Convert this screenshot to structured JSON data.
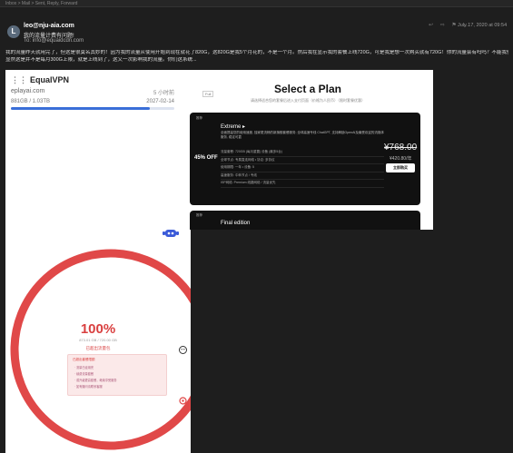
{
  "topbar": {
    "text": "Inbox > Mail > Sent, Reply, Forward"
  },
  "email": {
    "avatar_letter": "L",
    "from": "leo@nju-aia.com",
    "subject": "我的流量计费有问题!",
    "to_label": "To:",
    "to": "info@equaidcdn.com",
    "date": "July 17, 2020 at 09:54",
    "body_lines": [
      "我的流量昨天就用完了，但这是很莫名其妙的！因为我的流量从使用开始到现在就花了820G，这820G是我5个月花的，不是一个月。然后我在显示我的套餐上线720G，可是我是想一次购买就有720G！你的流量会有吗吗？不能我使用时累计，算上前面周期用完的量。",
      "显然这是并不是每月300G上限，就是上线到了，这又一次影响我的流量。你们这系统..."
    ]
  },
  "vpn_card": {
    "name": "EqualVPN",
    "domain": "eplayai.com",
    "updated_ago": "5 小时前",
    "usage": "881GB / 1.03TB",
    "expiry": "2027-02-14",
    "usage_fraction": 0.85
  },
  "plans": {
    "tag": "Full",
    "title": "Select a Plan",
    "subtitle": "请选择适合您的套餐后进入支付页面（价格为人民币）（限时套餐优惠）",
    "card1": {
      "badge": "推荐",
      "discount": "45% OFF",
      "name": "Extreme ▸",
      "description": "全面提高您的使用速度, 独家更流畅的新旗舰套餐服务; 全球高速专线 ChatGPT, 支持解锁OpenAI及最受欢迎的流媒体服务, 稳定可靠",
      "features": [
        "流量套餐: 720GB (每月重置) 设备 (最多5台)",
        "全球节点: 专属直连网络 • 协议: 多协议",
        "使用期限: 一年 • 设备: 5",
        "高速服务: 中转节点 / 专线",
        "ISP网络: Premium 线路网络 / 流量优先"
      ],
      "price_old": "¥768.00",
      "price_new": "¥420.80/年",
      "buy": "立即购买"
    },
    "card2": {
      "badge": "推荐",
      "name": "Final edition"
    }
  },
  "usage_panel": {
    "percent": "100%",
    "usage": "873.01 GB / 720.00 GB",
    "link": "已超出流量包",
    "warn_title": "已超出套餐限额",
    "warn_lines": [
      "· 流量已经用完",
      "· 续费流量套餐",
      "· 或升级更高套餐，继续享受服务",
      "· 如有疑问请联系客服"
    ],
    "fraction": 1.0,
    "ring_color": "#e04848"
  }
}
